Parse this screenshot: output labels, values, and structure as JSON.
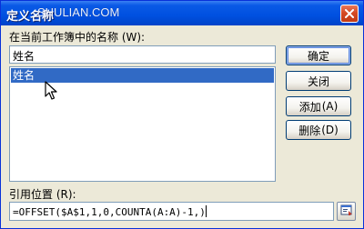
{
  "window": {
    "title": "定义名称",
    "watermark": "SHULIAN.COM"
  },
  "form": {
    "names_label": "在当前工作簿中的名称 (W):",
    "name_value": "姓名",
    "list_items": [
      "姓名"
    ],
    "refers_label": "引用位置 (R):",
    "refers_value": "=OFFSET($A$1,1,0,COUNTA(A:A)-1,)"
  },
  "buttons": {
    "ok": "确定",
    "close": "关闭",
    "add": "添加",
    "add_mnemonic": "(A)",
    "delete": "删除",
    "delete_mnemonic": "(D)"
  },
  "colors": {
    "title_bar": "#0050e0",
    "selection": "#316ac5",
    "dialog_bg": "#ece9d8",
    "close_button": "#d54a25"
  },
  "icons": {
    "close": "close-icon",
    "collapse": "collapse-dialog-icon",
    "cursor": "mouse-pointer-icon"
  }
}
